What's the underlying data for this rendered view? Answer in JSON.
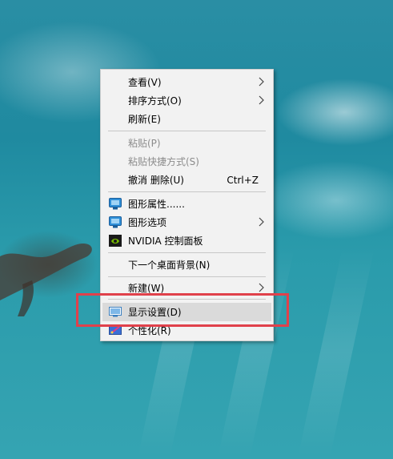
{
  "context_menu": {
    "items": [
      {
        "label": "查看(V)",
        "has_submenu": true
      },
      {
        "label": "排序方式(O)",
        "has_submenu": true
      },
      {
        "label": "刷新(E)"
      },
      {
        "label": "粘贴(P)",
        "disabled": true
      },
      {
        "label": "粘贴快捷方式(S)",
        "disabled": true
      },
      {
        "label": "撤消 删除(U)",
        "shortcut": "Ctrl+Z"
      },
      {
        "label": "图形属性......",
        "icon": "intel-graphics-icon"
      },
      {
        "label": "图形选项",
        "icon": "intel-graphics-icon",
        "has_submenu": true
      },
      {
        "label": "NVIDIA 控制面板",
        "icon": "nvidia-icon"
      },
      {
        "label": "下一个桌面背景(N)"
      },
      {
        "label": "新建(W)",
        "has_submenu": true
      },
      {
        "label": "显示设置(D)",
        "icon": "display-settings-icon",
        "highlighted": true
      },
      {
        "label": "个性化(R)",
        "icon": "personalize-icon"
      }
    ]
  },
  "colors": {
    "menu_background": "#f2f2f2",
    "hover_background": "#dadada",
    "annotation_red": "#e0414b",
    "disabled_text": "#8c8c8c"
  }
}
